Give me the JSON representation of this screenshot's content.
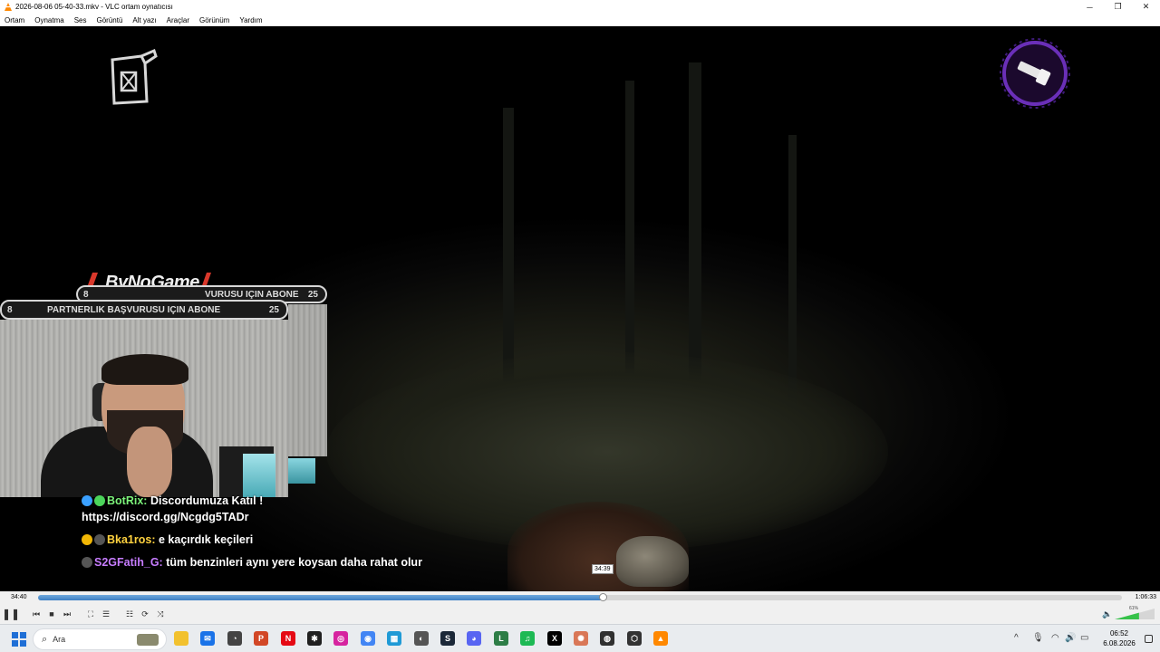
{
  "window": {
    "title": "2026-08-06 05-40-33.mkv - VLC ortam oynatıcısı",
    "minimize_glyph": "─",
    "maximize_glyph": "❐",
    "close_glyph": "✕"
  },
  "menu": [
    "Ortam",
    "Oynatma",
    "Ses",
    "Görüntü",
    "Alt yazı",
    "Araçlar",
    "Görünüm",
    "Yardım"
  ],
  "overlay": {
    "brand": "ByNoGame",
    "banner_back": {
      "left_num": "8",
      "text": "VURUSU IÇIN ABONE",
      "right_num": "25"
    },
    "banner_front": {
      "left_num": "8",
      "text": "PARTNERLIK BAŞVURUSU IÇIN ABONE",
      "right_num": "25"
    },
    "chat": [
      {
        "user": "BotRix:",
        "user_color": "#7cf27a",
        "message": "Discordumuza Katıl ! https://discord.gg/Ncgdg5TADr",
        "badges": [
          "#3aa0ff",
          "#4bd45a"
        ]
      },
      {
        "user": "Bka1ros:",
        "user_color": "#ffd23f",
        "message": "e kaçırdık keçileri",
        "badges": [
          "#f2b705",
          "#555555"
        ]
      },
      {
        "user": "S2GFatih_G:",
        "user_color": "#c77dff",
        "message": "tüm benzinleri aynı yere koysan daha rahat olur",
        "badges": [
          "#555555"
        ]
      }
    ]
  },
  "player": {
    "time_elapsed": "34:40",
    "time_total": "1:06:33",
    "hover_time": "34:39",
    "progress_fraction": 0.521,
    "volume_percent": "61%",
    "accent_color": "#3d7fc4",
    "buttons": {
      "pause": "❚❚",
      "prev": "⏮",
      "stop": "■",
      "next": "⏭",
      "fullscreen": "⛶",
      "extended": "☰",
      "playlist": "☷",
      "loop": "⟳",
      "shuffle": "⤨",
      "volume_icon": "🔈"
    }
  },
  "taskbar": {
    "search_placeholder": "Ara",
    "search_icon": "⌕",
    "apps": [
      {
        "name": "file-explorer-icon",
        "color": "#f2c12e",
        "glyph": ""
      },
      {
        "name": "outlook-icon",
        "color": "#1a73e8",
        "glyph": "✉"
      },
      {
        "name": "speed-icon",
        "color": "#444444",
        "glyph": "◔"
      },
      {
        "name": "powerpoint-icon",
        "color": "#d24726",
        "glyph": "P"
      },
      {
        "name": "netflix-icon",
        "color": "#e50914",
        "glyph": "N"
      },
      {
        "name": "chatgpt-icon",
        "color": "#202020",
        "glyph": "✱"
      },
      {
        "name": "instagram-icon",
        "color": "#d6249f",
        "glyph": "◎"
      },
      {
        "name": "chrome-icon",
        "color": "#4285f4",
        "glyph": "◉"
      },
      {
        "name": "store-icon",
        "color": "#1f9ad6",
        "glyph": "▦"
      },
      {
        "name": "mouse-app-icon",
        "color": "#555555",
        "glyph": "◐"
      },
      {
        "name": "steam-icon",
        "color": "#1b2838",
        "glyph": "S"
      },
      {
        "name": "discord-icon",
        "color": "#5865f2",
        "glyph": "◕"
      },
      {
        "name": "library-icon",
        "color": "#2d7d46",
        "glyph": "L"
      },
      {
        "name": "spotify-icon",
        "color": "#1db954",
        "glyph": "♫"
      },
      {
        "name": "x-icon",
        "color": "#000000",
        "glyph": "X"
      },
      {
        "name": "claude-icon",
        "color": "#d97757",
        "glyph": "✺"
      },
      {
        "name": "obs-icon",
        "color": "#303030",
        "glyph": "◍"
      },
      {
        "name": "unity-icon",
        "color": "#333333",
        "glyph": "⬡"
      },
      {
        "name": "vlc-icon",
        "color": "#ff8800",
        "glyph": "▲"
      }
    ],
    "tray": {
      "chevron": "^",
      "mic": "🎙",
      "wifi": "◠",
      "speaker": "🔊",
      "battery": "▭"
    },
    "clock_time": "06:52",
    "clock_date": "6.08.2026"
  }
}
